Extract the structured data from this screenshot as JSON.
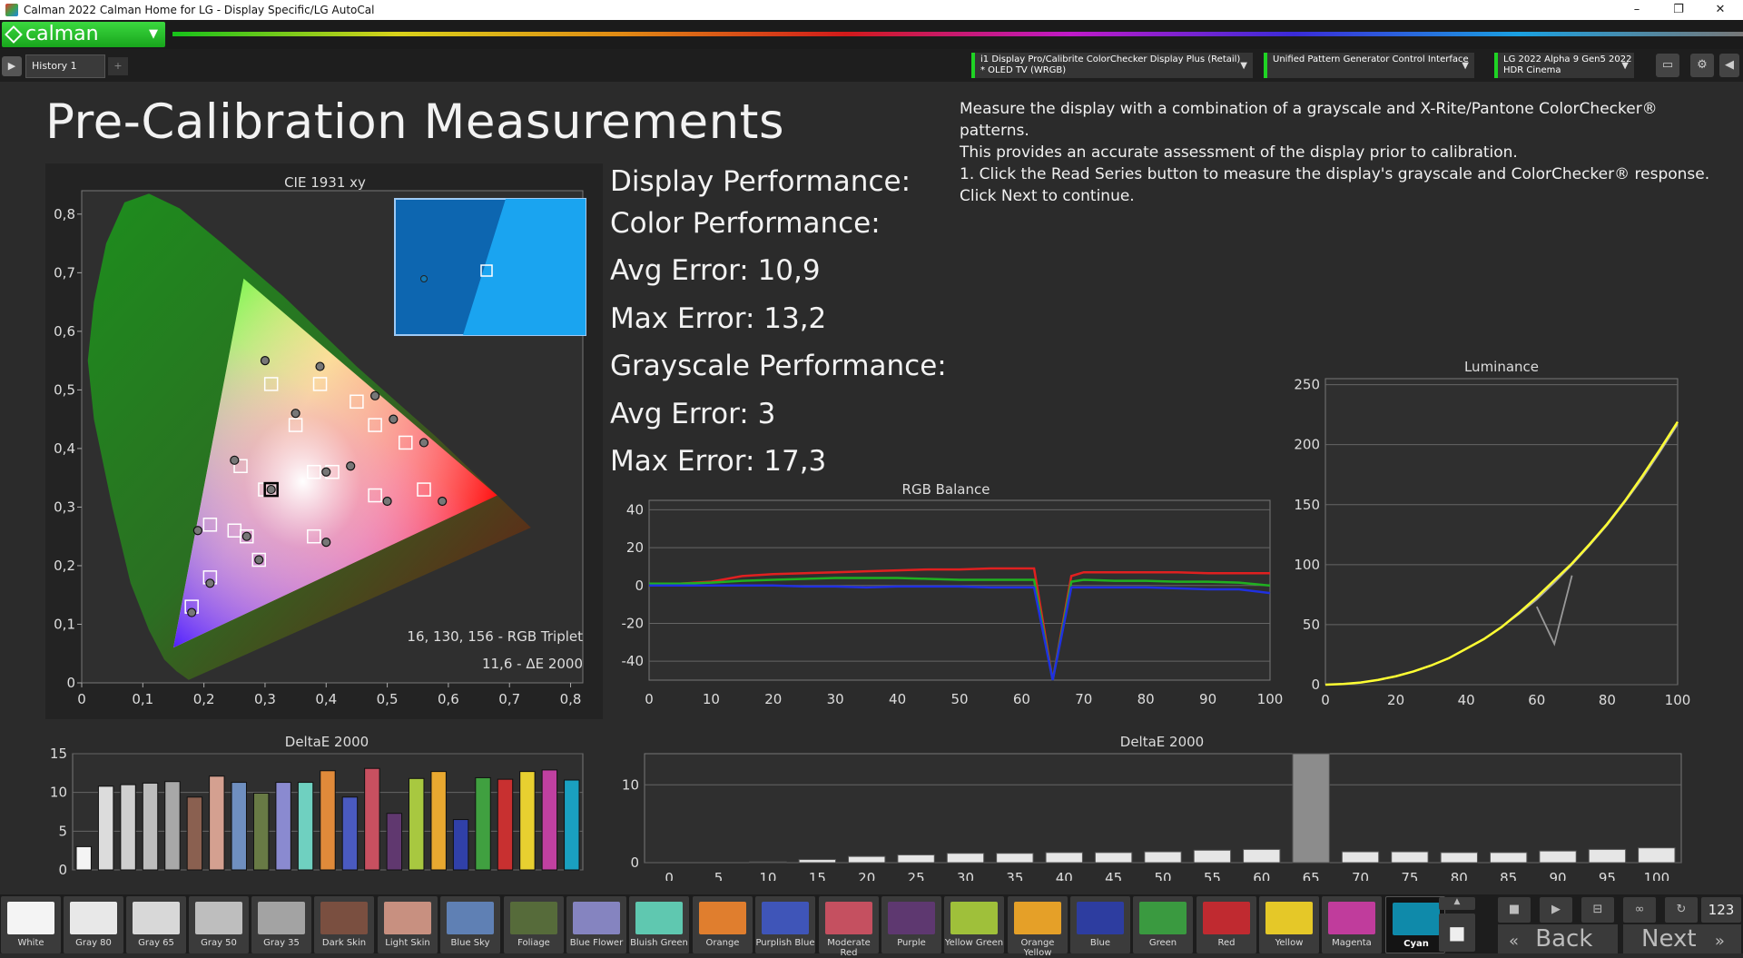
{
  "window": {
    "title": "Calman 2022 Calman Home for LG  - Display Specific/LG AutoCal",
    "controls": [
      "–",
      "❐",
      "✕"
    ]
  },
  "app": {
    "logo_text": "calman",
    "history_tab": "History 1",
    "add_tab": "+"
  },
  "devices": [
    {
      "line1": "i1 Display Pro/Calibrite ColorChecker Display Plus (Retail)",
      "line2": "* OLED TV (WRGB)"
    },
    {
      "line1": "Unified Pattern Generator Control Interface",
      "line2": ""
    },
    {
      "line1": "LG 2022 Alpha 9 Gen5 2022",
      "line2": "HDR Cinema"
    }
  ],
  "page": {
    "title": "Pre-Calibration Measurements",
    "instructions": [
      "Measure the display with a combination of a grayscale and X-Rite/Pantone ColorChecker® patterns.",
      "This provides an accurate assessment of the display prior to calibration.",
      "1. Click the Read Series button to measure the display's grayscale and ColorChecker® response.",
      "Click Next to continue."
    ]
  },
  "performance": {
    "display_heading": "Display Performance:",
    "color_heading": "Color Performance:",
    "color_avg": "Avg Error: 10,9",
    "color_max": "Max Error: 13,2",
    "gray_heading": "Grayscale Performance:",
    "gray_avg": "Avg Error: 3",
    "gray_max": "Max Error: 17,3"
  },
  "cie": {
    "rgb_triplet": "16, 130, 156 - RGB Triplet",
    "de_readout": "11,6 - ΔE 2000"
  },
  "chart_data": [
    {
      "type": "scatter",
      "title": "CIE 1931 xy",
      "xlim": [
        0,
        0.82
      ],
      "ylim": [
        0,
        0.84
      ],
      "xticks": [
        "0",
        "0,1",
        "0,2",
        "0,3",
        "0,4",
        "0,5",
        "0,6",
        "0,7",
        "0,8"
      ],
      "yticks": [
        "0",
        "0,1",
        "0,2",
        "0,3",
        "0,4",
        "0,5",
        "0,6",
        "0,7",
        "0,8"
      ],
      "gamut_triangle": [
        [
          0.68,
          0.32
        ],
        [
          0.265,
          0.69
        ],
        [
          0.15,
          0.06
        ]
      ],
      "targets": [
        [
          0.31,
          0.51
        ],
        [
          0.39,
          0.51
        ],
        [
          0.45,
          0.48
        ],
        [
          0.48,
          0.44
        ],
        [
          0.53,
          0.41
        ],
        [
          0.35,
          0.44
        ],
        [
          0.26,
          0.37
        ],
        [
          0.41,
          0.36
        ],
        [
          0.38,
          0.36
        ],
        [
          0.3,
          0.33
        ],
        [
          0.48,
          0.32
        ],
        [
          0.56,
          0.33
        ],
        [
          0.21,
          0.27
        ],
        [
          0.25,
          0.26
        ],
        [
          0.27,
          0.25
        ],
        [
          0.38,
          0.25
        ],
        [
          0.29,
          0.21
        ],
        [
          0.21,
          0.18
        ],
        [
          0.18,
          0.13
        ]
      ],
      "measured": [
        [
          0.3,
          0.55
        ],
        [
          0.39,
          0.54
        ],
        [
          0.48,
          0.49
        ],
        [
          0.51,
          0.45
        ],
        [
          0.56,
          0.41
        ],
        [
          0.35,
          0.46
        ],
        [
          0.25,
          0.38
        ],
        [
          0.44,
          0.37
        ],
        [
          0.4,
          0.36
        ],
        [
          0.31,
          0.33
        ],
        [
          0.5,
          0.31
        ],
        [
          0.59,
          0.31
        ],
        [
          0.19,
          0.26
        ],
        [
          0.27,
          0.25
        ],
        [
          0.29,
          0.21
        ],
        [
          0.4,
          0.24
        ],
        [
          0.21,
          0.17
        ],
        [
          0.18,
          0.12
        ]
      ],
      "highlight_target": [
        0.31,
        0.33
      ]
    },
    {
      "type": "line",
      "title": "RGB Balance",
      "x": [
        0,
        5,
        10,
        15,
        20,
        25,
        30,
        35,
        40,
        45,
        50,
        55,
        60,
        62,
        65,
        68,
        70,
        75,
        80,
        85,
        90,
        95,
        100
      ],
      "xlim": [
        0,
        100
      ],
      "ylim": [
        -50,
        45
      ],
      "xticks": [
        "0",
        "10",
        "20",
        "30",
        "40",
        "50",
        "60",
        "70",
        "80",
        "90",
        "100"
      ],
      "yticks": [
        "40",
        "20",
        "0",
        "-20",
        "-40"
      ],
      "series": [
        {
          "color": "#e02020",
          "values": [
            1,
            1,
            2,
            5,
            6,
            6.5,
            7,
            7.5,
            8,
            8.5,
            8.5,
            9,
            9,
            9,
            -50,
            5,
            7,
            7,
            7,
            7,
            6.5,
            6.5,
            6.5
          ]
        },
        {
          "color": "#20b020",
          "values": [
            1,
            1,
            1.5,
            2.5,
            3,
            3.5,
            4,
            4,
            4,
            3.5,
            3,
            3,
            3,
            3,
            -50,
            2,
            3,
            2.5,
            2.5,
            2,
            2,
            1.5,
            0
          ]
        },
        {
          "color": "#2030e0",
          "values": [
            0,
            0,
            0,
            0,
            0,
            -0.5,
            -0.5,
            -1,
            -0.5,
            -0.5,
            -0.5,
            -1,
            -1,
            -1,
            -50,
            -1,
            -1,
            -1,
            -1,
            -1.5,
            -2,
            -2,
            -4
          ]
        }
      ]
    },
    {
      "type": "line",
      "title": "Luminance",
      "xlim": [
        0,
        100
      ],
      "ylim": [
        0,
        255
      ],
      "xticks": [
        "0",
        "20",
        "40",
        "60",
        "80",
        "100"
      ],
      "yticks": [
        "250",
        "200",
        "150",
        "100",
        "50",
        "0"
      ],
      "series": [
        {
          "name": "target",
          "color": "#aaaaaa",
          "x": [
            0,
            5,
            10,
            15,
            20,
            25,
            30,
            35,
            40,
            45,
            50,
            55,
            60,
            65,
            70,
            75,
            80,
            85,
            90,
            95,
            100
          ],
          "values": [
            0,
            0.6,
            1.8,
            4,
            7,
            11,
            16,
            22,
            30,
            38,
            48,
            59,
            71,
            85,
            100,
            116,
            133,
            152,
            172,
            194,
            217
          ]
        },
        {
          "name": "measured",
          "color": "#ffff33",
          "x": [
            0,
            5,
            10,
            15,
            20,
            25,
            30,
            35,
            40,
            45,
            50,
            55,
            60,
            65,
            70,
            75,
            80,
            85,
            90,
            95,
            100
          ],
          "values": [
            0,
            0.6,
            1.8,
            4,
            7,
            11,
            16,
            22,
            30,
            38,
            48,
            60,
            73,
            87,
            101,
            117,
            134,
            153,
            174,
            196,
            219
          ]
        },
        {
          "name": "dip",
          "color": "#999999",
          "x": [
            60,
            65,
            70
          ],
          "values": [
            65,
            34,
            91
          ]
        }
      ]
    },
    {
      "type": "bar",
      "title": "DeltaE 2000",
      "ylim": [
        0,
        15
      ],
      "yticks": [
        "15",
        "10",
        "5",
        "0"
      ],
      "categories": [
        "White",
        "Gray 80",
        "Gray 65",
        "Gray 50",
        "Gray 35",
        "Dark Skin",
        "Light Skin",
        "Blue Sky",
        "Foliage",
        "Blue Flower",
        "Bluish Green",
        "Orange",
        "Purplish Blue",
        "Moderate Red",
        "Purple",
        "Yellow Green",
        "Orange Yellow",
        "Blue",
        "Green",
        "Red",
        "Yellow",
        "Magenta",
        "Cyan"
      ],
      "values": [
        3.0,
        10.8,
        11.0,
        11.2,
        11.4,
        9.4,
        12.1,
        11.3,
        9.9,
        11.3,
        11.3,
        12.8,
        9.4,
        13.1,
        7.3,
        11.8,
        12.7,
        6.5,
        11.9,
        11.7,
        12.7,
        12.9,
        11.6
      ],
      "colors": [
        "#f4f4f4",
        "#dcdcdc",
        "#cfcfcf",
        "#bdbdbd",
        "#a8a8a8",
        "#8a6050",
        "#d4a090",
        "#6f8fc0",
        "#687a45",
        "#8a8ad0",
        "#6fd0c0",
        "#e08a3a",
        "#4a5ac0",
        "#c85060",
        "#60386f",
        "#a8c840",
        "#e8a830",
        "#3040a8",
        "#40a040",
        "#c83030",
        "#e8d030",
        "#c040a0",
        "#1aa0c0"
      ]
    },
    {
      "type": "bar",
      "title": "DeltaE 2000",
      "ylim": [
        0,
        14
      ],
      "yticks": [
        "10",
        "0"
      ],
      "categories": [
        "0",
        "5",
        "10",
        "15",
        "20",
        "25",
        "30",
        "35",
        "40",
        "45",
        "50",
        "55",
        "60",
        "65",
        "70",
        "75",
        "80",
        "85",
        "90",
        "95",
        "100"
      ],
      "values": [
        0,
        0,
        0.1,
        0.4,
        0.8,
        1.0,
        1.2,
        1.2,
        1.3,
        1.3,
        1.4,
        1.6,
        1.7,
        17.3,
        1.4,
        1.4,
        1.3,
        1.3,
        1.5,
        1.7,
        1.9
      ]
    }
  ],
  "swatches": [
    {
      "label": "White",
      "color": "#f4f4f4"
    },
    {
      "label": "Gray 80",
      "color": "#e8e8e8"
    },
    {
      "label": "Gray 65",
      "color": "#d8d8d8"
    },
    {
      "label": "Gray 50",
      "color": "#bebebe"
    },
    {
      "label": "Gray 35",
      "color": "#a3a3a3"
    },
    {
      "label": "Dark Skin",
      "color": "#7a4f40"
    },
    {
      "label": "Light Skin",
      "color": "#c89080"
    },
    {
      "label": "Blue Sky",
      "color": "#5f80b4"
    },
    {
      "label": "Foliage",
      "color": "#566b3a"
    },
    {
      "label": "Blue Flower",
      "color": "#8584c0"
    },
    {
      "label": "Bluish Green",
      "color": "#5fc8b0"
    },
    {
      "label": "Orange",
      "color": "#e07e2e"
    },
    {
      "label": "Purplish Blue",
      "color": "#3f55b8"
    },
    {
      "label": "Moderate Red",
      "color": "#c55060"
    },
    {
      "label": "Purple",
      "color": "#5e3870"
    },
    {
      "label": "Yellow Green",
      "color": "#9fc03a"
    },
    {
      "label": "Orange Yellow",
      "color": "#e5a028"
    },
    {
      "label": "Blue",
      "color": "#2d3da0"
    },
    {
      "label": "Green",
      "color": "#3a9a40"
    },
    {
      "label": "Red",
      "color": "#c02a30"
    },
    {
      "label": "Yellow",
      "color": "#e5c828"
    },
    {
      "label": "Magenta",
      "color": "#c03c9c"
    },
    {
      "label": "Cyan",
      "color": "#0f8aaa"
    }
  ],
  "selected_swatch": "Cyan",
  "controls": {
    "counter": "123",
    "back_label": "Back",
    "next_label": "Next"
  }
}
